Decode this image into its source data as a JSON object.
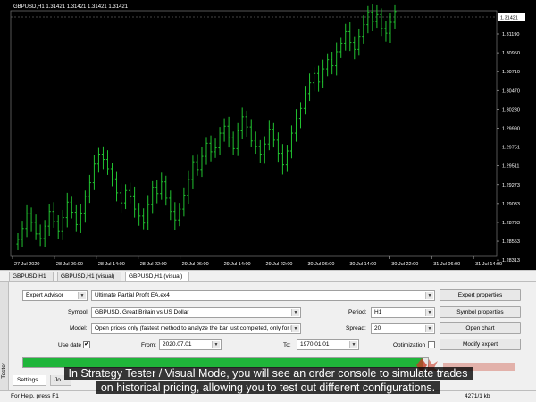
{
  "chart": {
    "info": "GBPUSD,H1  1.31421 1.31421 1.31421 1.31421",
    "last_price_label": "1.31421",
    "price_labels": [
      "1.31190",
      "1.30950",
      "1.30710",
      "1.30470",
      "1.30230",
      "1.29990",
      "1.29751",
      "1.29511",
      "1.29273",
      "1.29033",
      "1.28793",
      "1.28553",
      "1.28313"
    ],
    "time_labels": [
      "27 Jul 2020",
      "28 Jul 06:00",
      "28 Jul 14:00",
      "28 Jul 22:00",
      "29 Jul 06:00",
      "29 Jul 14:00",
      "29 Jul 22:00",
      "30 Jul 06:00",
      "30 Jul 14:00",
      "30 Jul 22:00",
      "31 Jul 06:00",
      "31 Jul 14:00"
    ],
    "colors": {
      "background": "#000000",
      "bars": "#21c230",
      "grid": "#3c3c3c",
      "axis_text": "#ffffff"
    },
    "closes": [
      1.2848,
      1.2862,
      1.2881,
      1.287,
      1.2855,
      1.2849,
      1.2865,
      1.2884,
      1.2871,
      1.2858,
      1.2876,
      1.2896,
      1.2883,
      1.2867,
      1.2882,
      1.2903,
      1.2921,
      1.2945,
      1.2958,
      1.2951,
      1.2939,
      1.2926,
      1.2908,
      1.2895,
      1.2911,
      1.2904,
      1.2887,
      1.2878,
      1.2869,
      1.2893,
      1.2915,
      1.2907,
      1.2922,
      1.2901,
      1.2884,
      1.2873,
      1.2887,
      1.2905,
      1.2925,
      1.2948,
      1.2938,
      1.2955,
      1.2972,
      1.2961,
      1.2966,
      1.2985,
      1.2994,
      1.2979,
      1.2965,
      1.2988,
      1.3006,
      1.2993,
      1.2975,
      1.2968,
      1.2958,
      1.2971,
      1.299,
      1.2976,
      1.2959,
      1.2944,
      1.2962,
      1.2985,
      1.3004,
      1.3017,
      1.3036,
      1.305,
      1.3062,
      1.3051,
      1.3068,
      1.308,
      1.3072,
      1.309,
      1.3101,
      1.3116,
      1.3102,
      1.3093,
      1.311,
      1.3125,
      1.3141,
      1.3129,
      1.3138,
      1.312,
      1.3114,
      1.3128,
      1.3142
    ]
  },
  "chart_tabs": [
    "GBPUSD,H1",
    "GBPUSD,H1 (visual)",
    "GBPUSD,H1 (visual)"
  ],
  "tester": {
    "side_label": "Tester",
    "type_select": "Expert Advisor",
    "ea_select": "Ultimate Partial Profit EA.ex4",
    "symbol_label": "Symbol:",
    "symbol_value": "GBPUSD, Great Britain vs US Dollar",
    "period_label": "Period:",
    "period_value": "H1",
    "model_label": "Model:",
    "model_value": "Open prices only (fastest method to analyze the bar just completed, only for E",
    "spread_label": "Spread:",
    "spread_value": "20",
    "use_date_label": "Use date",
    "use_date_checked": "✔",
    "from_label": "From:",
    "from_value": "2020.07.01",
    "to_label": "To:",
    "to_value": "1970.01.01",
    "optimization_label": "Optimization",
    "buttons": {
      "expert_properties": "Expert properties",
      "symbol_properties": "Symbol properties",
      "open_chart": "Open chart",
      "modify_expert": "Modify expert"
    },
    "progress": 0.99,
    "progress_color": "#1fb53a"
  },
  "bottom_tabs": [
    "Settings",
    "Jo"
  ],
  "statusbar": {
    "help": "For Help, press F1",
    "traffic": "4271/1 kb"
  },
  "caption": {
    "line1": "In Strategy Tester / Visual Mode, you will see an order console to simulate trades",
    "line2": "on historical pricing, allowing you to test out different configurations."
  }
}
